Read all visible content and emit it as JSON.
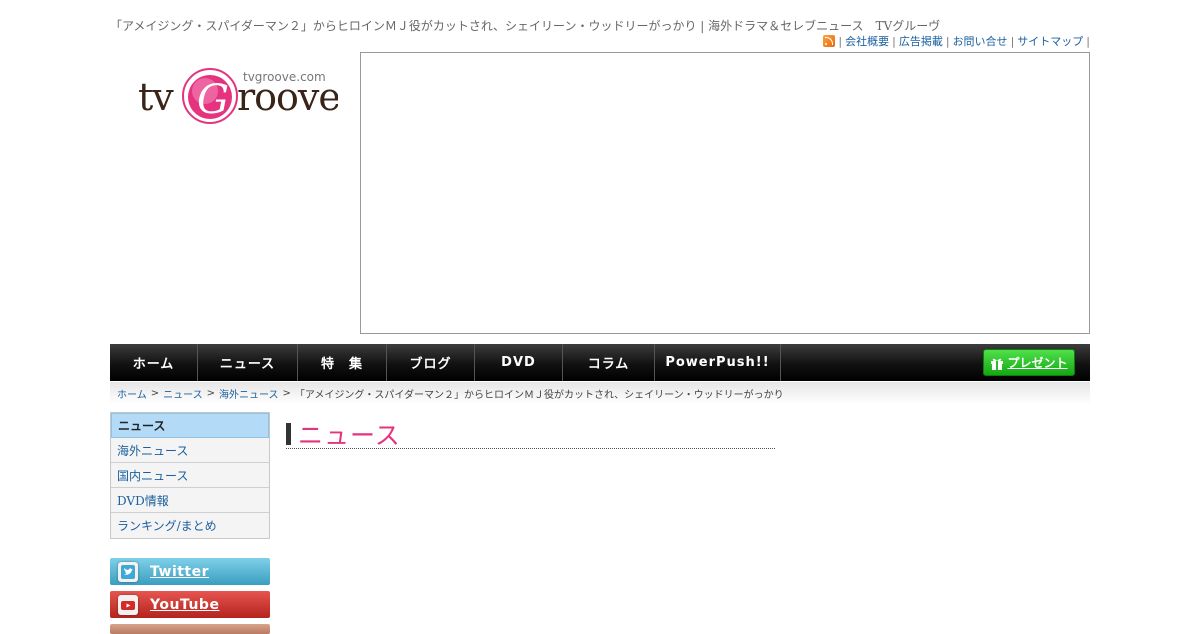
{
  "page_title": "「アメイジング・スパイダーマン２」からヒロインＭＪ役がカットされ、シェイリーン・ウッドリーがっかり | 海外ドラマ＆セレブニュース　TVグルーヴ",
  "util_links": [
    "会社概要",
    "広告掲載",
    "お問い合せ",
    "サイトマップ"
  ],
  "util_separator": "|",
  "logo": {
    "domain_text": "tvgroove.com",
    "brand_left": "tv",
    "brand_letter": "G",
    "brand_right": "roove"
  },
  "nav": {
    "items": [
      "ホーム",
      "ニュース",
      "特　集",
      "ブログ",
      "DVD",
      "コラム",
      "PowerPush!!"
    ],
    "present_label": "プレゼント"
  },
  "breadcrumb": {
    "links": [
      "ホーム",
      "ニュース",
      "海外ニュース"
    ],
    "separator": ">",
    "current": "「アメイジング・スパイダーマン２」からヒロインＭＪ役がカットされ、シェイリーン・ウッドリーがっかり"
  },
  "sidebar": {
    "items": [
      "ニュース",
      "海外ニュース",
      "国内ニュース",
      "DVD情報",
      "ランキング/まとめ"
    ]
  },
  "social": {
    "twitter": "Twitter",
    "youtube": "YouTube"
  },
  "section_heading": "ニュース",
  "colors": {
    "nav_bg": "#111111",
    "accent_pink": "#e5337f",
    "link_blue": "#1a5f9e",
    "sidebar_active": "#b3dbf7",
    "present_green": "#22c21f"
  }
}
